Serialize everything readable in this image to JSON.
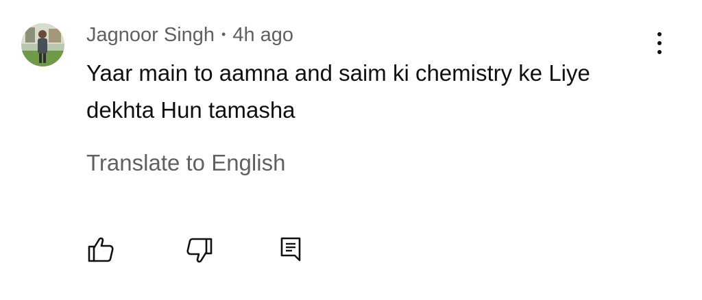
{
  "comment": {
    "author": "Jagnoor Singh",
    "separator": "•",
    "time": "4h ago",
    "text": "Yaar main to aamna and saim ki chemistry ke Liye dekhta Hun tamasha",
    "translate_label": "Translate to English"
  },
  "icons": {
    "menu": "more-vert-icon",
    "like": "thumbs-up-icon",
    "dislike": "thumbs-down-icon",
    "reply": "reply-comment-icon"
  },
  "colors": {
    "primary_text": "#0f0f0f",
    "secondary_text": "#606060",
    "background": "#ffffff"
  }
}
